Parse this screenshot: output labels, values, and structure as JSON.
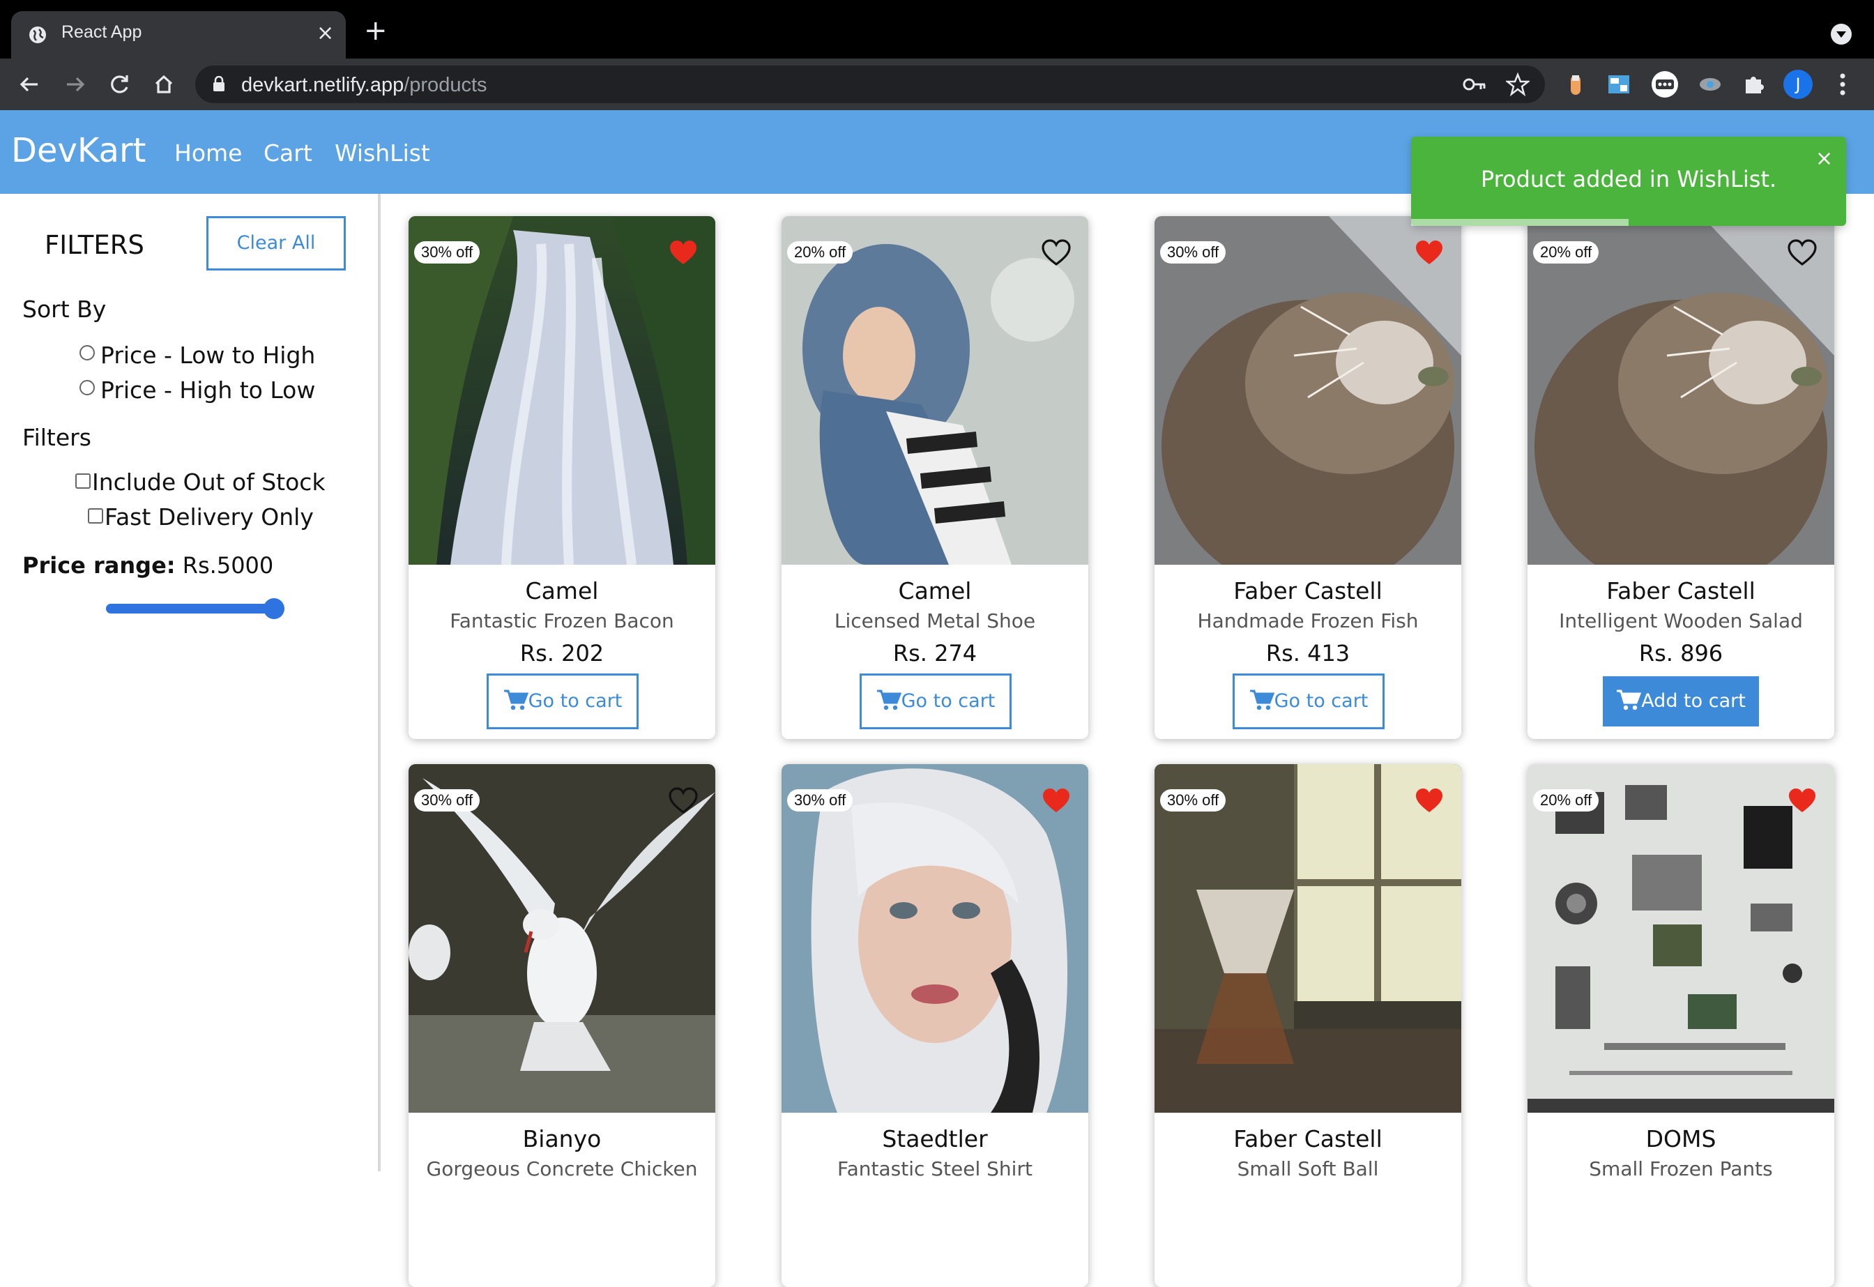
{
  "browser": {
    "tab_title": "React App",
    "tab_close": "×",
    "new_tab": "+",
    "url_host": "devkart.netlify.app",
    "url_path": "/products",
    "profile_initial": "J"
  },
  "app": {
    "brand": "DevKart",
    "nav": [
      "Home",
      "Cart",
      "WishList"
    ]
  },
  "toast": {
    "message": "Product added in WishList.",
    "close": "×",
    "progress": 0.5
  },
  "sidebar": {
    "title": "FILTERS",
    "clear_label": "Clear All",
    "sort_title": "Sort By",
    "sort_options": [
      "Price - Low to High",
      "Price - High to Low"
    ],
    "filters_title": "Filters",
    "filter_options": [
      "Include Out of Stock",
      "Fast Delivery Only"
    ],
    "price_label": "Price range:",
    "price_value": "Rs.5000",
    "slider_level": 1.0
  },
  "products": [
    {
      "discount": "30% off",
      "brand": "Camel",
      "name": "Fantastic Frozen Bacon",
      "price": "Rs. 202",
      "button": "Go to cart",
      "wishlisted": true,
      "image": "waterfall"
    },
    {
      "discount": "20% off",
      "brand": "Camel",
      "name": "Licensed Metal Shoe",
      "price": "Rs. 274",
      "button": "Go to cart",
      "wishlisted": false,
      "image": "woman-scarf"
    },
    {
      "discount": "30% off",
      "brand": "Faber Castell",
      "name": "Handmade Frozen Fish",
      "price": "Rs. 413",
      "button": "Go to cart",
      "wishlisted": true,
      "image": "cat"
    },
    {
      "discount": "20% off",
      "brand": "Faber Castell",
      "name": "Intelligent Wooden Salad",
      "price": "Rs. 896",
      "button": "Add to cart",
      "wishlisted": false,
      "image": "cat"
    },
    {
      "discount": "30% off",
      "brand": "Bianyo",
      "name": "Gorgeous Concrete Chicken",
      "price": "",
      "button": "",
      "wishlisted": false,
      "image": "seagull"
    },
    {
      "discount": "30% off",
      "brand": "Staedtler",
      "name": "Fantastic Steel Shirt",
      "price": "",
      "button": "",
      "wishlisted": true,
      "image": "woman-white-hair"
    },
    {
      "discount": "30% off",
      "brand": "Faber Castell",
      "name": "Small Soft Ball",
      "price": "",
      "button": "",
      "wishlisted": true,
      "image": "coffee-window"
    },
    {
      "discount": "20% off",
      "brand": "DOMS",
      "name": "Small Frozen Pants",
      "price": "",
      "button": "",
      "wishlisted": true,
      "image": "camera-parts"
    }
  ],
  "colors": {
    "header": "#5ba3e4",
    "accent": "#3d8bd8",
    "toast": "#4bb43c",
    "heart": "#e8291c"
  }
}
